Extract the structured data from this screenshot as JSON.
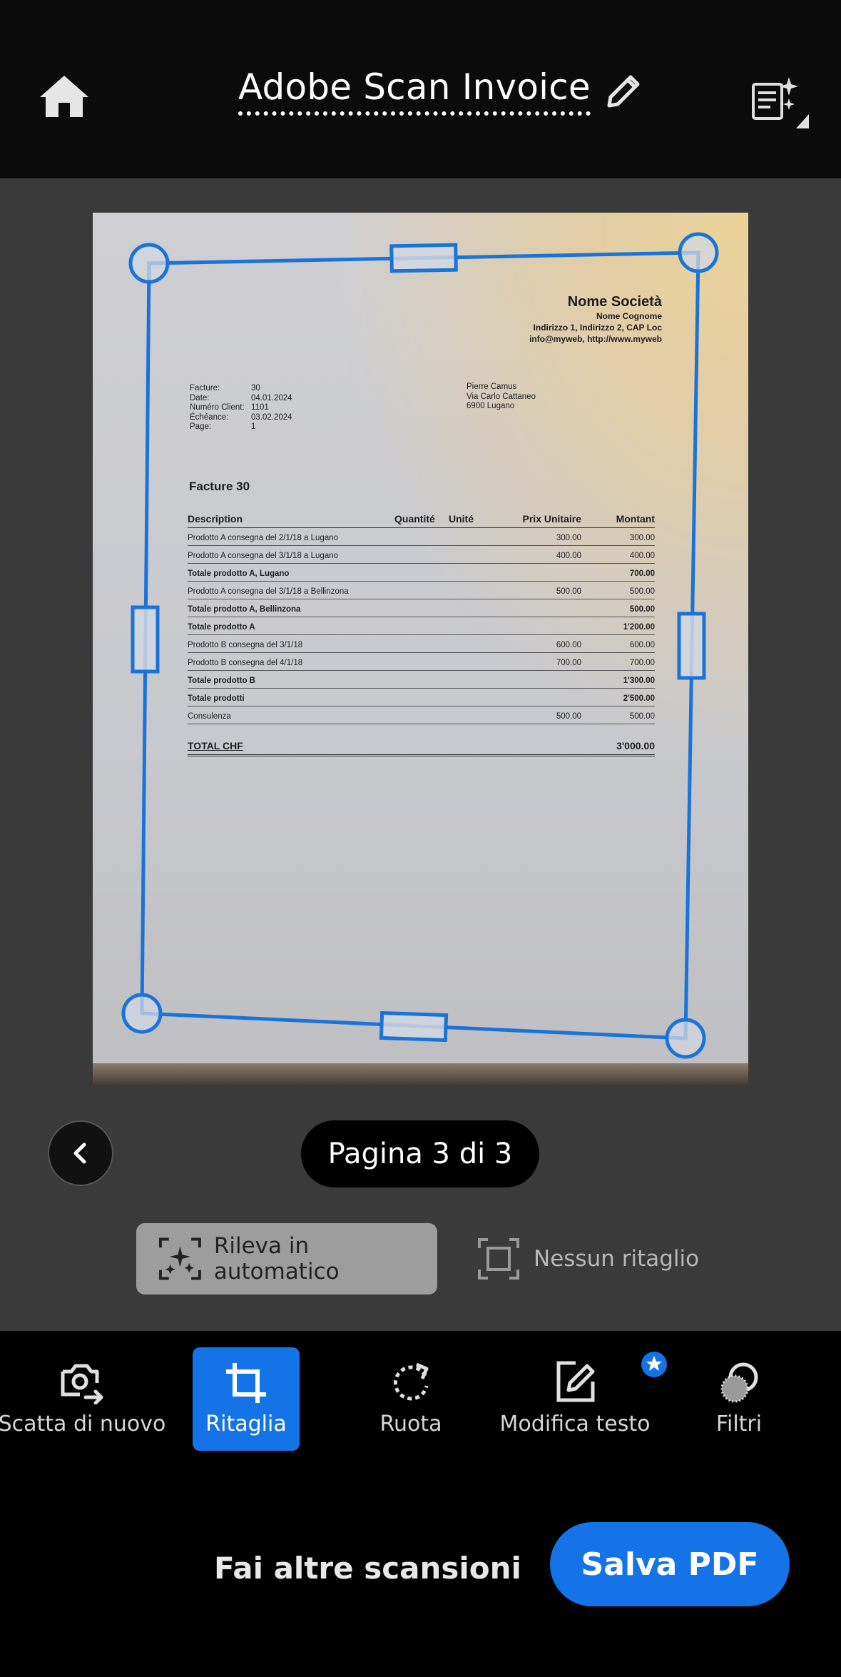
{
  "header": {
    "title": "Adobe Scan Invoice",
    "home_icon": "home-icon",
    "edit_icon": "pencil-icon",
    "ai_icon": "document-sparkle-icon"
  },
  "document": {
    "company": {
      "name": "Nome Società",
      "contact": "Nome Cognome",
      "address": "Indirizzo 1, Indirizzo 2, CAP Loc",
      "web": "info@myweb, http://www.myweb"
    },
    "meta_labels": [
      "Facture:",
      "Date:",
      "Numéro Client:",
      "Échéance:",
      "Page:"
    ],
    "meta_values": [
      "30",
      "04.01.2024",
      "1101",
      "03.02.2024",
      "1"
    ],
    "recipient": [
      "Pierre Camus",
      "Via Carlo Cattaneo",
      "6900 Lugano"
    ],
    "invoice_title": "Facture 30",
    "table_headers": {
      "description": "Description",
      "quantity": "Quantité",
      "unit": "Unité",
      "unit_price": "Prix Unitaire",
      "amount": "Montant"
    },
    "rows": [
      {
        "description": "Prodotto A consegna del 2/1/18 a Lugano",
        "price": "300.00",
        "amount": "300.00",
        "bold": false
      },
      {
        "description": "Prodotto A consegna del 3/1/18 a Lugano",
        "price": "400.00",
        "amount": "400.00",
        "bold": false
      },
      {
        "description": "Totale prodotto A, Lugano",
        "price": "",
        "amount": "700.00",
        "bold": true
      },
      {
        "description": "Prodotto A consegna del 3/1/18 a Bellinzona",
        "price": "500.00",
        "amount": "500.00",
        "bold": false
      },
      {
        "description": "Totale prodotto A, Bellinzona",
        "price": "",
        "amount": "500.00",
        "bold": true
      },
      {
        "description": "Totale prodotto A",
        "price": "",
        "amount": "1'200.00",
        "bold": true
      },
      {
        "description": "Prodotto B consegna del 3/1/18",
        "price": "600.00",
        "amount": "600.00",
        "bold": false
      },
      {
        "description": "Prodotto B consegna del 4/1/18",
        "price": "700.00",
        "amount": "700.00",
        "bold": false
      },
      {
        "description": "Totale prodotto B",
        "price": "",
        "amount": "1'300.00",
        "bold": true
      },
      {
        "description": "Totale prodotti",
        "price": "",
        "amount": "2'500.00",
        "bold": true
      },
      {
        "description": "Consulenza",
        "price": "500.00",
        "amount": "500.00",
        "bold": false
      }
    ],
    "total_label": "TOTAL CHF",
    "total_value": "3'000.00"
  },
  "pager": {
    "label": "Pagina 3 di 3",
    "prev_icon": "chevron-left-icon"
  },
  "crop_modes": {
    "auto": "Rileva in automatico",
    "none": "Nessun ritaglio"
  },
  "tools": [
    {
      "label": "Scatta di nuovo",
      "icon": "retake-camera-icon"
    },
    {
      "label": "Ritaglia",
      "icon": "crop-icon"
    },
    {
      "label": "Ruota",
      "icon": "rotate-icon"
    },
    {
      "label": "Modifica testo",
      "icon": "edit-text-icon"
    },
    {
      "label": "Filtri",
      "icon": "filters-icon"
    }
  ],
  "actions": {
    "more_scans": "Fai altre scansioni",
    "save_pdf": "Salva PDF"
  },
  "colors": {
    "accent": "#1473e6",
    "canvas": "#3a3a3a",
    "crop_line": "#1a73d9"
  }
}
